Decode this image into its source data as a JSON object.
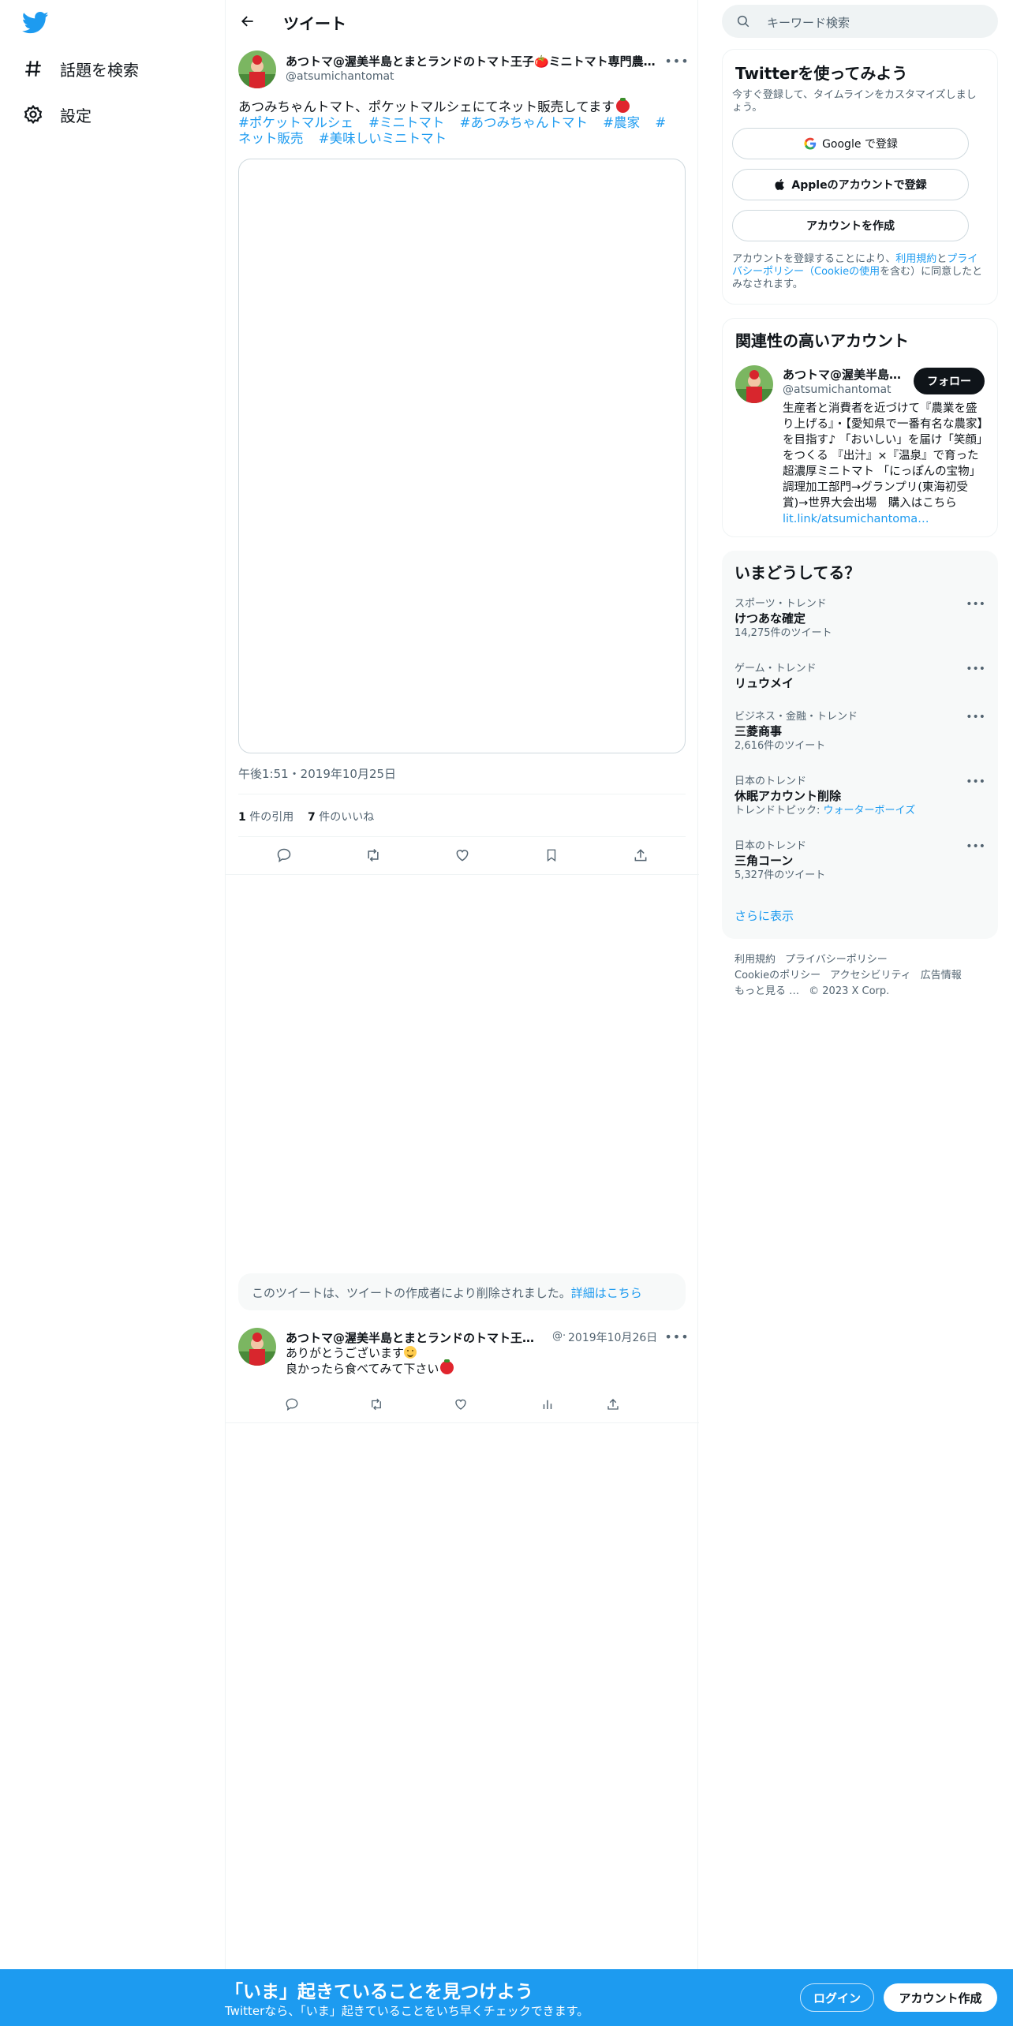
{
  "nav": {
    "explore_label": "話題を検索",
    "settings_label": "設定"
  },
  "header": {
    "title": "ツイート"
  },
  "tweet": {
    "author_name": "あつトマ@渥美半島とまとランドのトマト王子🍅ミニトマト専門農…",
    "author_handle": "@atsumichantomat",
    "text": "あつみちゃんトマト、ポケットマルシェにてネット販売してます",
    "hashtags": [
      "#ポケットマルシェ",
      "#ミニトマト",
      "#あつみちゃんトマト",
      "#農家",
      "#ネット販売",
      "#美味しいミニトマト"
    ],
    "time": "午後1:51・2019年10月25日",
    "quote_count": "1",
    "quote_label": "件の引用",
    "like_count": "7",
    "like_label": "件のいいね"
  },
  "deleted_notice": {
    "text": "このツイートは、ツイートの作成者により削除されました。",
    "link": "詳細はこちら"
  },
  "reply": {
    "author_name": "あつトマ@渥美半島とまとランドのトマト王子…",
    "author_handle": "@·",
    "date": "2019年10月26日",
    "line1": "ありがとうございます",
    "line2": "良かったら食べてみて下さい"
  },
  "search": {
    "placeholder": "キーワード検索"
  },
  "signup_card": {
    "title": "Twitterを使ってみよう",
    "subtitle": "今すぐ登録して、タイムラインをカスタマイズしましょう。",
    "google_label": "Google で登録",
    "apple_label": "Appleのアカウントで登録",
    "create_label": "アカウントを作成",
    "legal_prefix": "アカウントを登録することにより、",
    "legal_terms": "利用規約",
    "legal_and": "と",
    "legal_privacy": "プライバシーポリシー",
    "legal_cookie": "（Cookieの使用",
    "legal_suffix": "を含む）に同意したとみなされます。"
  },
  "related": {
    "title": "関連性の高いアカウント",
    "name": "あつトマ@渥美半島…",
    "handle": "@atsumichantomat",
    "follow_label": "フォロー",
    "bio": "生産者と消費者を近づけて『農業を盛り上げる』・【愛知県で一番有名な農家】を目指す♪ 「おいしい」を届け「笑顔」をつくる 『出汁』×『温泉』で育った超濃厚ミニトマト 「にっぽんの宝物」調理加工部門→グランプリ(東海初受賞)→世界大会出場　購入はこちら",
    "bio_link": "lit.link/atsumichantoma…"
  },
  "trends": {
    "title": "いまどうしてる？",
    "items": [
      {
        "context": "スポーツ・トレンド",
        "name": "けつあな確定",
        "count": "14,275件のツイート"
      },
      {
        "context": "ゲーム・トレンド",
        "name": "リュウメイ",
        "count": ""
      },
      {
        "context": "ビジネス・金融・トレンド",
        "name": "三菱商事",
        "count": "2,616件のツイート"
      },
      {
        "context": "日本のトレンド",
        "name": "休眠アカウント削除",
        "count_prefix": "トレンドトピック: ",
        "count_link": "ウォーターボーイズ"
      },
      {
        "context": "日本のトレンド",
        "name": "三角コーン",
        "count": "5,327件のツイート"
      }
    ],
    "show_more": "さらに表示"
  },
  "footer": {
    "terms": "利用規約",
    "privacy": "プライバシーポリシー",
    "cookie": "Cookieのポリシー",
    "accessibility": "アクセシビリティ",
    "ads": "広告情報",
    "more": "もっと見る …",
    "copyright": "© 2023 X Corp."
  },
  "bottom_bar": {
    "title": "「いま」起きていることを見つけよう",
    "subtitle": "Twitterなら、「いま」起きていることをいち早くチェックできます。",
    "login_label": "ログイン",
    "signup_label": "アカウント作成"
  },
  "colors": {
    "brand_blue": "#1d9bf0",
    "text_primary": "#0f1419",
    "text_secondary": "#536471"
  }
}
